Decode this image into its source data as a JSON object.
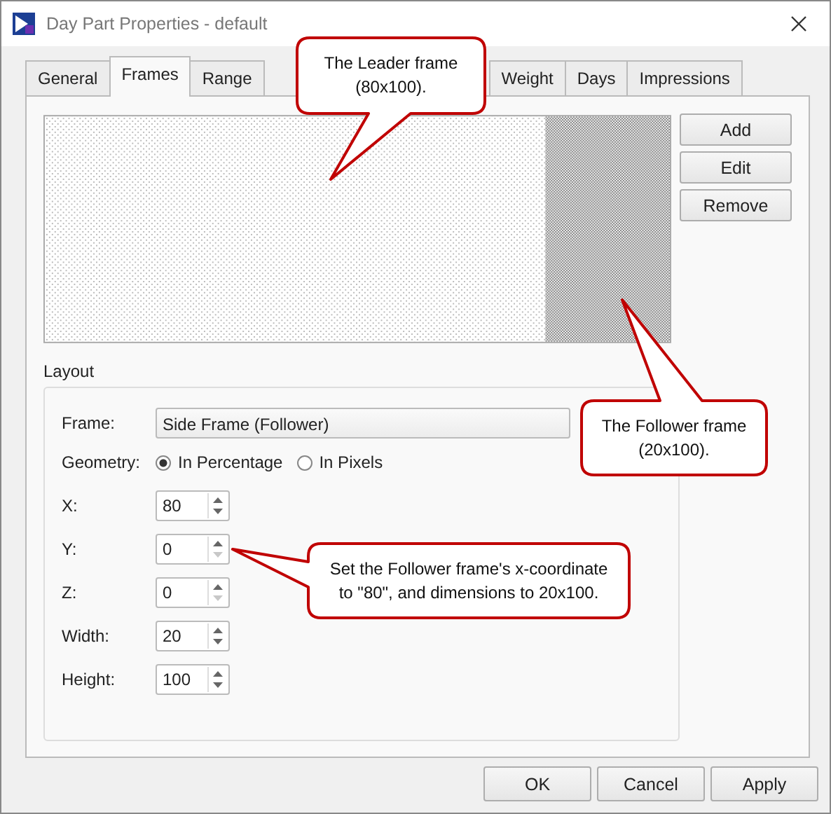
{
  "window": {
    "title": "Day Part Properties - default"
  },
  "tabs": [
    {
      "label": "General",
      "selected": false
    },
    {
      "label": "Frames",
      "selected": true
    },
    {
      "label": "Range",
      "selected": false
    },
    {
      "label": "Weight",
      "selected": false
    },
    {
      "label": "Days",
      "selected": false
    },
    {
      "label": "Impressions",
      "selected": false
    }
  ],
  "side_buttons": [
    "Add",
    "Edit",
    "Remove"
  ],
  "layout": {
    "title": "Layout",
    "frame_label": "Frame:",
    "frame_value": "Side Frame (Follower)",
    "geometry_label": "Geometry:",
    "geometry_options": [
      {
        "label": "In Percentage",
        "selected": true
      },
      {
        "label": "In Pixels",
        "selected": false
      }
    ],
    "fields": [
      {
        "label": "X:",
        "value": "80",
        "down_disabled": false
      },
      {
        "label": "Y:",
        "value": "0",
        "down_disabled": true
      },
      {
        "label": "Z:",
        "value": "0",
        "down_disabled": true
      },
      {
        "label": "Width:",
        "value": "20",
        "down_disabled": false
      },
      {
        "label": "Height:",
        "value": "100",
        "down_disabled": false
      }
    ]
  },
  "footer_buttons": [
    "OK",
    "Cancel",
    "Apply"
  ],
  "callouts": [
    {
      "text": "The Leader frame\n(80x100)."
    },
    {
      "text": "The Follower frame\n(20x100)."
    },
    {
      "text": "Set the Follower frame's x-coordinate\nto \"80\", and dimensions to 20x100."
    }
  ]
}
